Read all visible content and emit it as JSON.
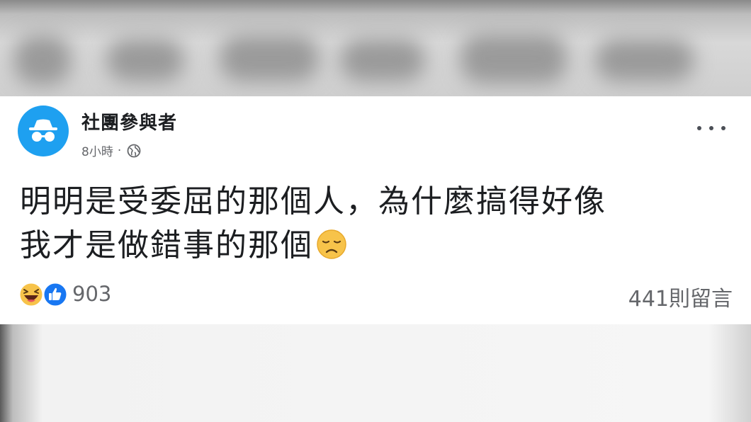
{
  "post": {
    "author": "社團參與者",
    "time": "8小時",
    "separator": "·",
    "privacy_icon": "globe-icon",
    "lines": [
      "明明是受委屈的那個人，為什麼搞得好像",
      "我才是做錯事的那個"
    ],
    "inline_emoji": "disappointed-face-emoji",
    "reactions": [
      "laughing-emoji",
      "like-icon"
    ],
    "reaction_count": "903",
    "comment_count": "441則留言"
  },
  "colors": {
    "avatar_bg": "#1ea0f0",
    "text_primary": "#1c1e21",
    "text_secondary": "#65676b",
    "like_blue": "#1877f2",
    "emoji_yellow": "#f7c34a"
  }
}
